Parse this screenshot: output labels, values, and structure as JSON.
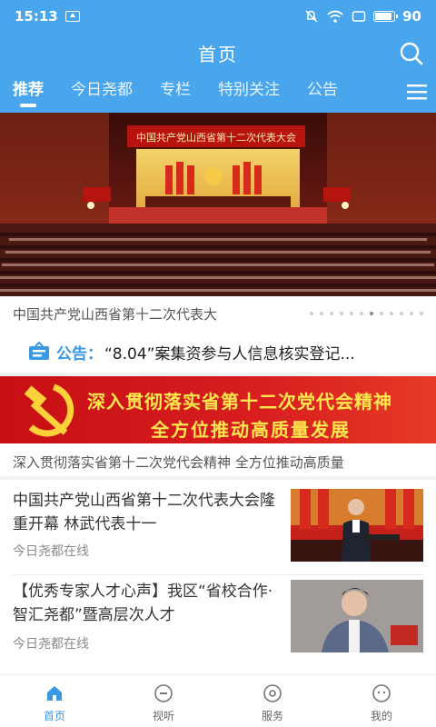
{
  "status_bar": {
    "time": "15:13",
    "battery": "90"
  },
  "header": {
    "title": "首页"
  },
  "tabs": [
    {
      "label": "推荐",
      "active": true
    },
    {
      "label": "今日尧都",
      "active": false
    },
    {
      "label": "专栏",
      "active": false
    },
    {
      "label": "特别关注",
      "active": false
    },
    {
      "label": "公告",
      "active": false
    }
  ],
  "banner": {
    "hall_sign": "中国共产党山西省第十二次代表大会",
    "caption": "中国共产党山西省第十二次代表大",
    "dots_total": 12,
    "dots_active_index": 7
  },
  "notice": {
    "label": "公告：",
    "text": "“8.04”案集资参与人信息核实登记..."
  },
  "promo": {
    "line1": "深入贯彻落实省第十二次党代会精神",
    "line2": "全方位推动高质量发展",
    "caption": "深入贯彻落实省第十二次党代会精神 全方位推动高质量"
  },
  "news": [
    {
      "title": "中国共产党山西省第十二次代表大会隆重开幕 林武代表十一",
      "source": "今日尧都在线"
    },
    {
      "title": "【优秀专家人才心声】我区“省校合作·智汇尧都”暨高层次人才",
      "source": "今日尧都在线"
    }
  ],
  "bottom_nav": [
    {
      "label": "首页",
      "icon": "home-icon",
      "active": true
    },
    {
      "label": "视听",
      "icon": "video-icon",
      "active": false
    },
    {
      "label": "服务",
      "icon": "service-icon",
      "active": false
    },
    {
      "label": "我的",
      "icon": "profile-icon",
      "active": false
    }
  ],
  "colors": {
    "accent": "#49a6ec",
    "party_red": "#d81e1f",
    "promo_text": "#ffe84d"
  }
}
